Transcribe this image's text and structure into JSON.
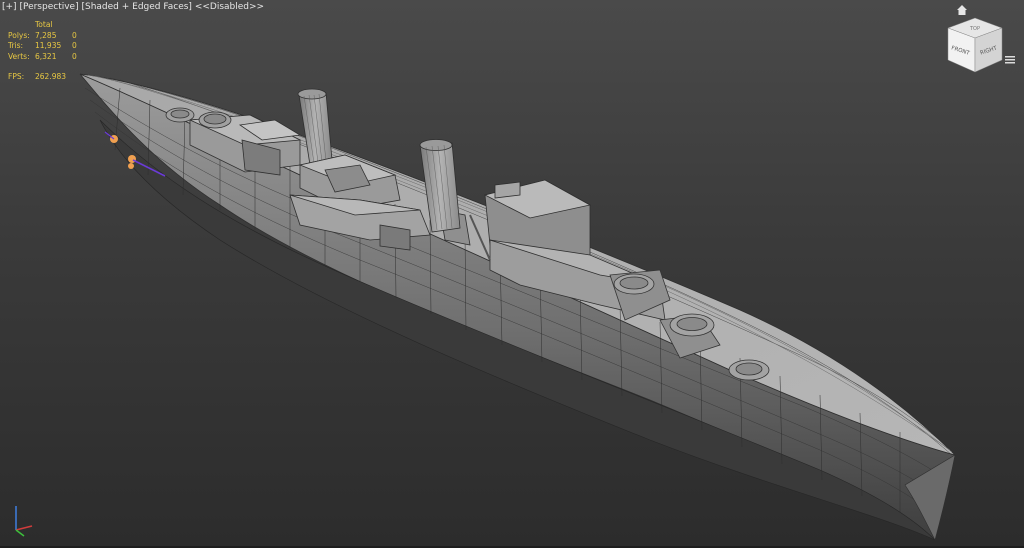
{
  "viewport": {
    "plus": "[+]",
    "view": "[Perspective]",
    "shading": "[Shaded + Edged Faces]",
    "disabled": "<<Disabled>>"
  },
  "stats": {
    "header": "Total",
    "polys_label": "Polys:",
    "polys_total": "7,285",
    "polys_sel": "0",
    "tris_label": "Tris:",
    "tris_total": "11,935",
    "tris_sel": "0",
    "verts_label": "Verts:",
    "verts_total": "6,321",
    "verts_sel": "0",
    "fps_label": "FPS:",
    "fps_value": "262.983"
  },
  "viewcube": {
    "top": "TOP",
    "front": "FRONT",
    "right": "RIGHT"
  },
  "colors": {
    "bg_top": "#4a4a4a",
    "bg_bottom": "#2c2c2c",
    "stats_text": "#e8c843",
    "mesh_light": "#a9a9a9",
    "mesh_dark": "#555555",
    "edges": "#2f2f2f",
    "gizmo_orange": "#f0a050",
    "gizmo_purple": "#6a3bd6"
  },
  "icons": [
    "home-icon",
    "viewcube-menu-icon",
    "axis-tripod-icon"
  ]
}
